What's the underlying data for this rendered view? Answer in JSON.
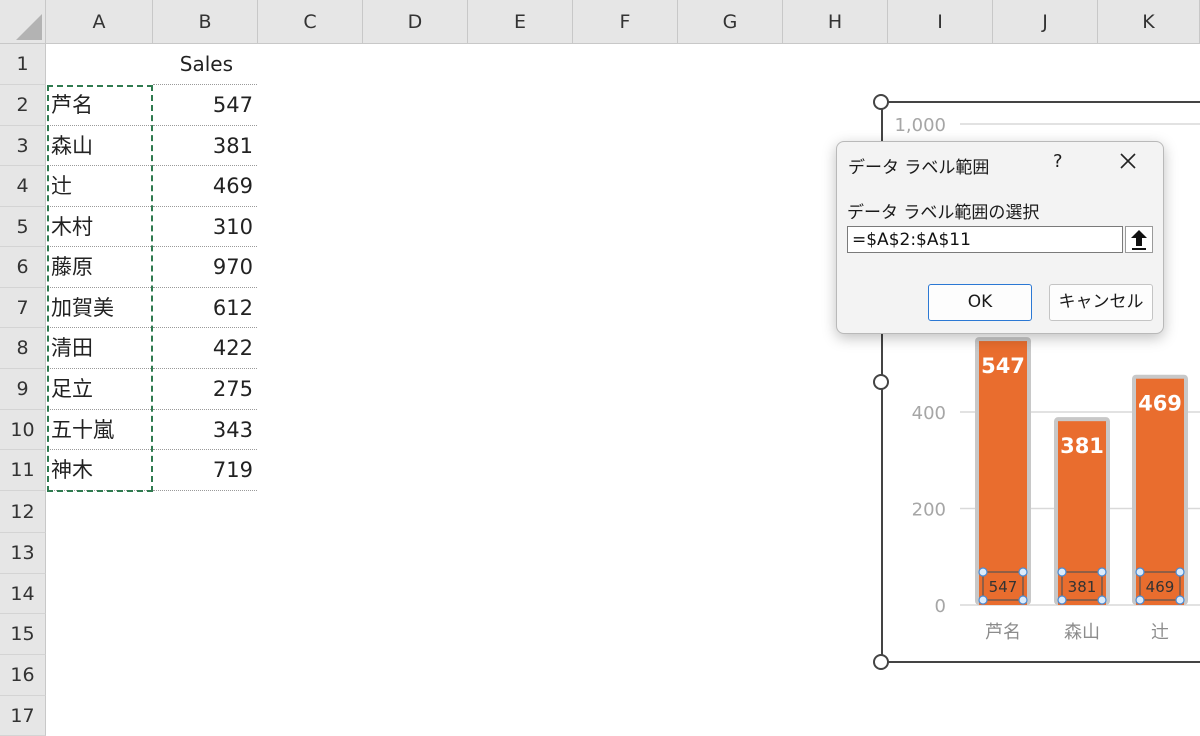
{
  "sheet": {
    "columns": [
      "A",
      "B",
      "C",
      "D",
      "E",
      "F",
      "G",
      "H",
      "I",
      "J",
      "K"
    ],
    "rows": [
      "1",
      "2",
      "3",
      "4",
      "5",
      "6",
      "7",
      "8",
      "9",
      "10",
      "11",
      "12",
      "13",
      "14",
      "15",
      "16",
      "17"
    ],
    "header_label": "Sales",
    "data": [
      {
        "name": "芦名",
        "value": "547"
      },
      {
        "name": "森山",
        "value": "381"
      },
      {
        "name": "辻",
        "value": "469"
      },
      {
        "name": "木村",
        "value": "310"
      },
      {
        "name": "藤原",
        "value": "970"
      },
      {
        "name": "加賀美",
        "value": "612"
      },
      {
        "name": "清田",
        "value": "422"
      },
      {
        "name": "足立",
        "value": "275"
      },
      {
        "name": "五十嵐",
        "value": "343"
      },
      {
        "name": "神木",
        "value": "719"
      }
    ]
  },
  "chart_data": {
    "type": "bar",
    "categories": [
      "芦名",
      "森山",
      "辻"
    ],
    "values": [
      547,
      381,
      469
    ],
    "inner_labels": [
      "547",
      "381",
      "469"
    ],
    "y_ticks": [
      "0",
      "200",
      "400",
      "1,000"
    ],
    "y_tick_values": [
      0,
      200,
      400,
      1000
    ],
    "ylim": [
      0,
      1000
    ],
    "bar_color": "#e96d2e",
    "bar_outline_color": "#c8c8c8",
    "grid": true
  },
  "dialog": {
    "title": "データ ラベル範囲",
    "help": "?",
    "prompt": "データ ラベル範囲の選択",
    "range_value": "=$A$2:$A$11",
    "ok_label": "OK",
    "cancel_label": "キャンセル"
  },
  "colors": {
    "selection_border": "#2f7a4f",
    "ok_border": "#2b78d4",
    "header_bg": "#e6e6e6"
  }
}
